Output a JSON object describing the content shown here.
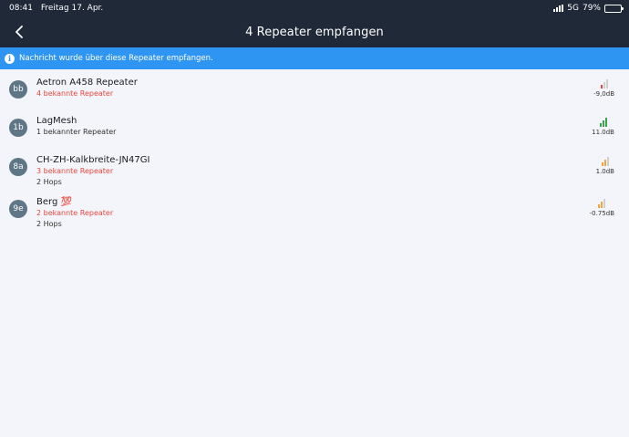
{
  "status_bar": {
    "time": "08:41",
    "date": "Freitag 17. Apr.",
    "network": "5G",
    "battery": "79%",
    "battery_level": 0.79
  },
  "header": {
    "title": "4 Repeater empfangen",
    "back_icon": "chevron-left-icon"
  },
  "banner": {
    "icon": "info-icon",
    "text": "Nachricht wurde über diese Repeater empfangen."
  },
  "colors": {
    "header_bg": "#1f2937",
    "banner_bg": "#2f95f3",
    "avatar_bg": "#5f7686",
    "red": "#e5483f",
    "green": "#3aa64c",
    "orange": "#f2a33a"
  },
  "repeaters": [
    {
      "avatar": "bb",
      "name": "Aetron A458 Repeater",
      "line1": "4 bekannte Repeater",
      "line2": "",
      "signal": "-9,0dB",
      "level": 1,
      "color": "#e5483f"
    },
    {
      "avatar": "1b",
      "name": "LagMesh",
      "line1": "1 bekannter Repeater",
      "line2": "",
      "signal": "11.0dB",
      "level": 3,
      "color": "#3aa64c"
    },
    {
      "avatar": "8a",
      "name": "CH-ZH-Kalkbreite-JN47GI",
      "line1": "3 bekannte Repeater",
      "line2": "2 Hops",
      "signal": "1.0dB",
      "level": 2,
      "color": "#f2a33a"
    },
    {
      "avatar": "9e",
      "name": "Berg 💯",
      "line1": "2 bekannte Repeater",
      "line2": "2 Hops",
      "signal": "-0.75dB",
      "level": 2,
      "color": "#f2a33a"
    }
  ]
}
